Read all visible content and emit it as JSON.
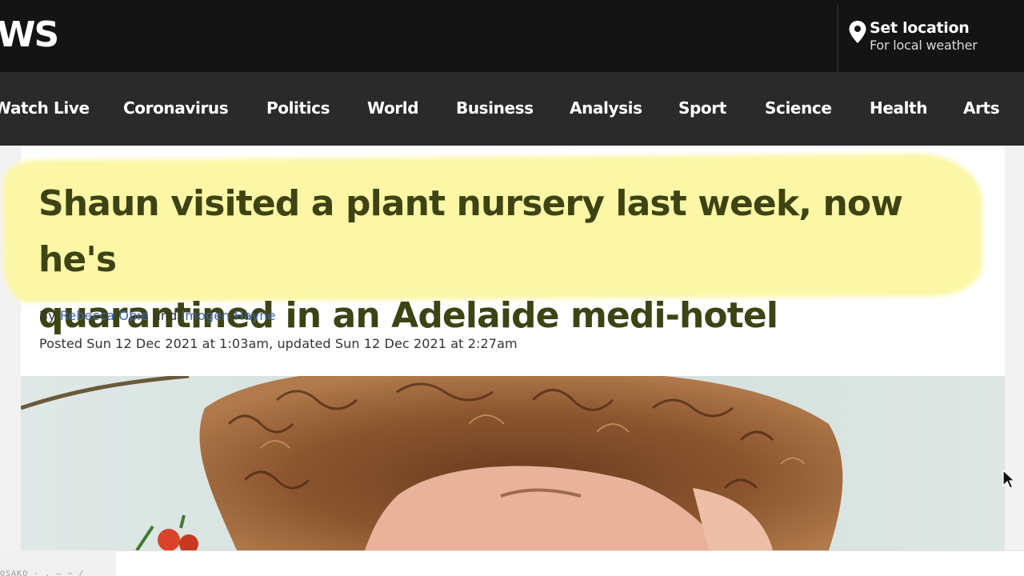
{
  "header": {
    "logo_fragment": "WS",
    "location": {
      "title": "Set location",
      "subtitle": "For local weather",
      "icon": "location-pin-icon"
    }
  },
  "nav": {
    "items": [
      {
        "label": "Watch Live"
      },
      {
        "label": "Coronavirus"
      },
      {
        "label": "Politics"
      },
      {
        "label": "World"
      },
      {
        "label": "Business"
      },
      {
        "label": "Analysis"
      },
      {
        "label": "Sport"
      },
      {
        "label": "Science"
      },
      {
        "label": "Health"
      },
      {
        "label": "Arts"
      }
    ]
  },
  "article": {
    "headline_line1": "Shaun visited a plant nursery last week, now he's",
    "headline_line2": "quarantined in an Adelaide medi-hotel",
    "byline": {
      "by": "By",
      "author1": "Rebecca Opie",
      "and": "and",
      "author2": "Imogen Hayne"
    },
    "dates": "Posted Sun 12 Dec 2021 at 1:03am, updated Sun 12 Dec 2021 at 2:27am"
  },
  "footer_fragment": "OSAKO · . – ∼ /",
  "colors": {
    "header_bg": "#141414",
    "nav_bg": "#2a2a2a",
    "headline": "#3e4314",
    "highlight": "#fbf7a6",
    "author_link": "#3e65b5"
  }
}
